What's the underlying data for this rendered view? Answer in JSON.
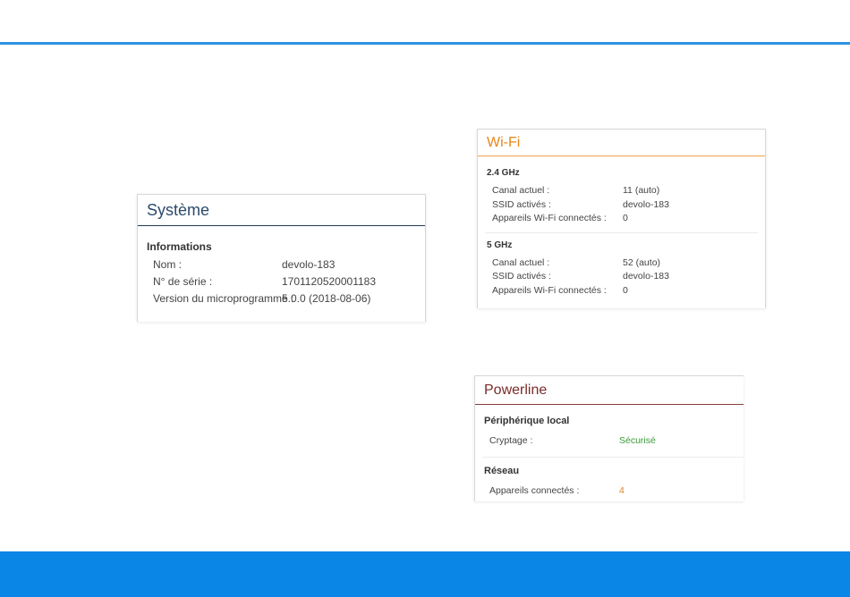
{
  "systeme": {
    "title": "Système",
    "section": "Informations",
    "rows": [
      {
        "label": "Nom :",
        "value": "devolo-183"
      },
      {
        "label": "N° de série :",
        "value": "1701120520001183"
      },
      {
        "label": "Version du microprogramme :",
        "value": "5.0.0 (2018-08-06)"
      }
    ]
  },
  "wifi": {
    "title": "Wi-Fi",
    "bands": [
      {
        "heading": "2.4 GHz",
        "rows": [
          {
            "label": "Canal actuel :",
            "value": "11 (auto)"
          },
          {
            "label": "SSID activés :",
            "value": "devolo-183"
          },
          {
            "label": "Appareils Wi-Fi connectés :",
            "value": "0"
          }
        ]
      },
      {
        "heading": "5 GHz",
        "rows": [
          {
            "label": "Canal actuel :",
            "value": "52 (auto)"
          },
          {
            "label": "SSID activés :",
            "value": "devolo-183"
          },
          {
            "label": "Appareils Wi-Fi connectés :",
            "value": "0"
          }
        ]
      }
    ]
  },
  "powerline": {
    "title": "Powerline",
    "local": {
      "heading": "Périphérique local",
      "rows": [
        {
          "label": "Cryptage :",
          "value": "Sécurisé"
        }
      ]
    },
    "network": {
      "heading": "Réseau",
      "rows": [
        {
          "label": "Appareils connectés :",
          "value": "4"
        }
      ]
    }
  },
  "colors": {
    "accent_blue": "#0a86e6",
    "wifi_orange": "#e8861a",
    "powerline_red": "#7b2a2a",
    "status_ok": "#3a9a3a",
    "status_warn": "#d9822b"
  }
}
